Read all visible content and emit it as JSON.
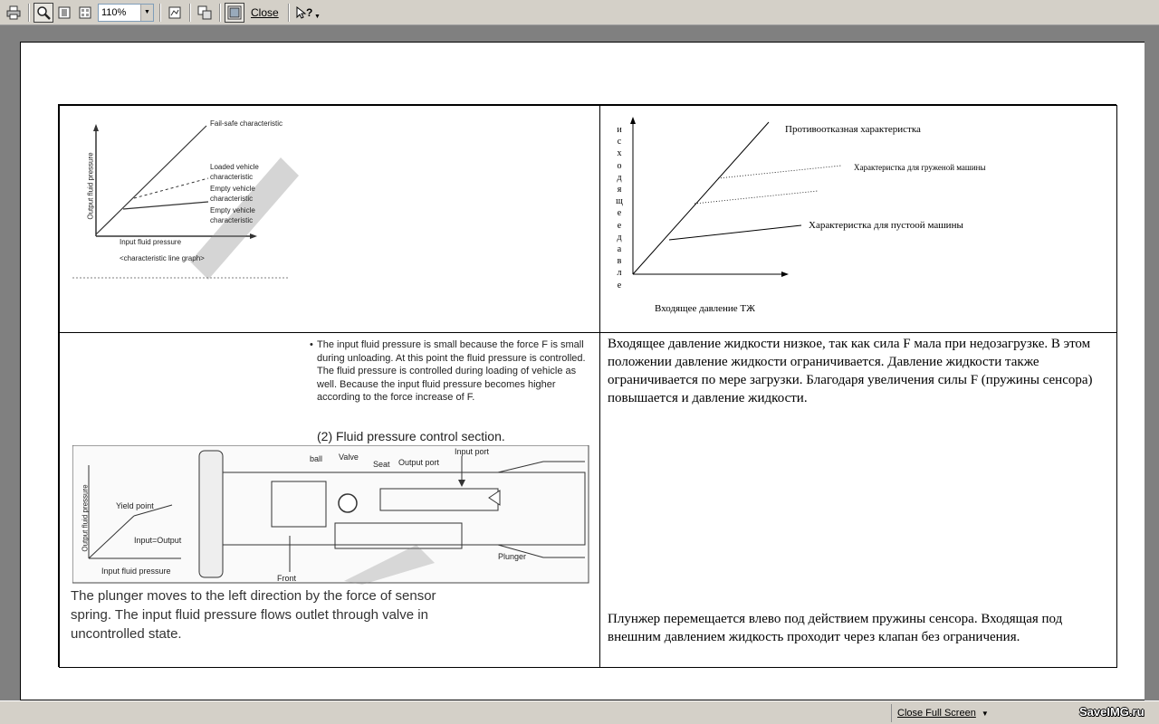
{
  "toolbar": {
    "zoom_value": "110%",
    "close_label": "Close",
    "icons": [
      "print-icon",
      "zoom-tool-icon",
      "one-page-icon",
      "multi-page-icon",
      "zoom-dropdown-icon",
      "thumbnail-icon",
      "multi-window-icon",
      "full-screen-icon",
      "help-icon"
    ]
  },
  "document": {
    "graph1": {
      "labels": {
        "failsafe": "Fail-safe characteristic",
        "loaded": "Loaded vehicle characteristic",
        "empty": "Empty vehicle characteristic",
        "empty2": "Empty vehicle characteristic",
        "xlabel": "Input fluid pressure",
        "ylabel": "Output fluid pressure",
        "caption": "<characteristic line graph>"
      }
    },
    "graph2": {
      "ylabel_letters": [
        "и",
        "с",
        "х",
        "о",
        "д",
        "я",
        "щ",
        "е",
        "е",
        "д",
        "а",
        "в",
        "л",
        "е"
      ],
      "xlabel": "Входящее давление ТЖ",
      "line_failsafe": "Противоотказная характеристка",
      "line_loaded": "Характеристка для груженой машины",
      "line_empty": "Характеристка для пустоой машины"
    },
    "scan_bullet": "The input fluid pressure is small because the force F is small during unloading. At this point the fluid pressure is controlled. The fluid pressure is controlled during loading of vehicle as well. Because the input fluid pressure becomes higher according to the force increase of F.",
    "scan_bullet_dot": "•",
    "section_title": "(2) Fluid pressure control section.",
    "diagram_labels": {
      "ball": "ball",
      "valve": "Valve",
      "seat": "Seat",
      "output_port": "Output port",
      "input_port": "Input port",
      "plunger": "Plunger",
      "front": "Front",
      "yield_point": "Yield point",
      "input_output": "Input=Output",
      "ylabel": "Output fluid pressure",
      "xlabel": "Input fluid pressure"
    },
    "scan_bottom": "The plunger moves to the left direction by the force of sensor spring. The input fluid pressure flows outlet through valve in uncontrolled state.",
    "ru_top": "Входящее давление жидкости низкое, так как сила F мала при недозагрузке. В этом положении давление жидкости ограничивается. Давление жидкости также ограничивается по мере загрузки. Благодаря увеличения силы F (пружины сенсора) повышается и давление жидкости.",
    "ru_bottom": "Плунжер перемещается влево под действием пружины сенсора. Входящая под внешним давлением жидкость проходит через клапан без ограничения."
  },
  "statusbar": {
    "close_full_screen": "Close Full Screen",
    "watermark": "SaveIMG.ru"
  }
}
